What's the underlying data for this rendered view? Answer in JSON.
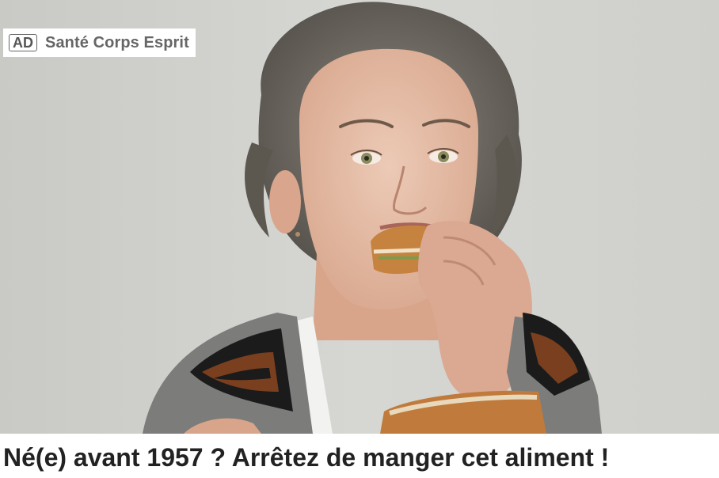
{
  "ad": {
    "badge": "AD",
    "sponsor": "Santé Corps Esprit",
    "headline": "Né(e) avant 1957 ? Arrêtez de manger cet aliment !",
    "image": {
      "subject": "woman-eating-sandwich",
      "colors": {
        "background": "#d3d3cf",
        "hair": "#6f6a62",
        "skin": "#e4b8a2",
        "bread": "#c6833f",
        "cardigan_gray": "#7c7c7a",
        "cardigan_black": "#1b1b1b",
        "cardigan_brown": "#7a3f1e"
      }
    }
  }
}
